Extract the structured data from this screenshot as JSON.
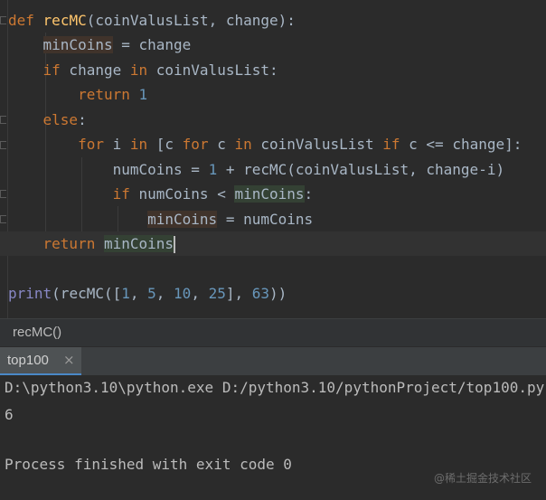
{
  "code": {
    "line1": {
      "def": "def",
      "name": "recMC",
      "rest": "(coinValusList, change):"
    },
    "line2": {
      "indent": "    ",
      "var": "minCoins",
      "rest": " = change"
    },
    "line3": {
      "indent": "    ",
      "kw_if": "if",
      "mid": " change ",
      "kw_in": "in",
      "rest": " coinValusList:"
    },
    "line4": {
      "indent": "        ",
      "kw_return": "return",
      "sp": " ",
      "num": "1"
    },
    "line5": {
      "indent": "    ",
      "kw_else": "else",
      "rest": ":"
    },
    "line6": {
      "indent": "        ",
      "kw_for": "for",
      "a": " i ",
      "kw_in": "in",
      "b": " [c ",
      "kw_for2": "for",
      "c": " c ",
      "kw_in2": "in",
      "d": " coinValusList ",
      "kw_if": "if",
      "e": " c <= change]:"
    },
    "line7": {
      "indent": "            ",
      "a": "numCoins = ",
      "num": "1",
      "b": " + recMC(coinValusList, change-i)"
    },
    "line8": {
      "indent": "            ",
      "kw_if": "if",
      "a": " numCoins < ",
      "var": "minCoins",
      "b": ":"
    },
    "line9": {
      "indent": "                ",
      "var": "minCoins",
      "b": " = numCoins"
    },
    "line10": {
      "indent": "    ",
      "kw_return": "return",
      "sp": " ",
      "var": "minCoins"
    },
    "line12": {
      "builtin": "print",
      "a": "(recMC([",
      "n1": "1",
      "s1": ", ",
      "n2": "5",
      "s2": ", ",
      "n3": "10",
      "s3": ", ",
      "n4": "25",
      "a2": "], ",
      "n5": "63",
      "end": "))"
    }
  },
  "breadcrumb": {
    "label": "recMC()"
  },
  "run_tab": {
    "label": "top100",
    "close": "×"
  },
  "console": {
    "command": "D:\\python3.10\\python.exe D:/python3.10/pythonProject/top100.py",
    "output": "6",
    "exit": "Process finished with exit code 0"
  },
  "watermark": "@稀土掘金技术社区"
}
